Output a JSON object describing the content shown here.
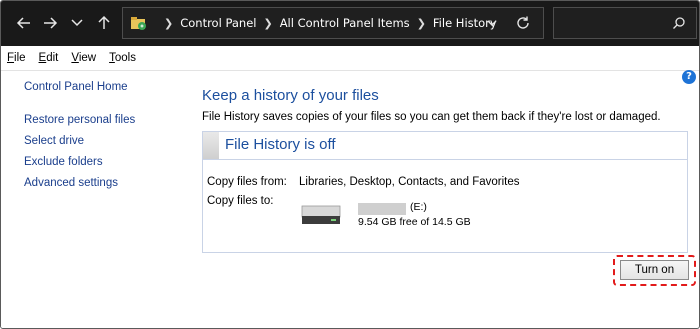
{
  "nav": {
    "back_icon": "arrow-left-icon",
    "forward_icon": "arrow-right-icon",
    "recent_icon": "chevron-down-icon",
    "up_icon": "arrow-up-icon"
  },
  "address": {
    "crumbs": [
      "Control Panel",
      "All Control Panel Items",
      "File History"
    ],
    "refresh_icon": "refresh-icon"
  },
  "search": {
    "icon": "search-icon"
  },
  "menu": [
    "File",
    "Edit",
    "View",
    "Tools"
  ],
  "sidebar": {
    "home": "Control Panel Home",
    "links": [
      "Restore personal files",
      "Select drive",
      "Exclude folders",
      "Advanced settings"
    ]
  },
  "main": {
    "heading": "Keep a history of your files",
    "description": "File History saves copies of your files so you can get them back if they're lost or damaged.",
    "status_title": "File History is off",
    "copy_from_label": "Copy files from:",
    "copy_from_value": "Libraries, Desktop, Contacts, and Favorites",
    "copy_to_label": "Copy files to:",
    "drive_letter": "(E:)",
    "drive_free": "9.54 GB free of 14.5 GB",
    "turn_on_label": "Turn on"
  },
  "colors": {
    "accent_heading": "#1c4f9e",
    "link": "#1a3e8c",
    "highlight_dashed": "#e21b1b",
    "help": "#1e73d6"
  }
}
